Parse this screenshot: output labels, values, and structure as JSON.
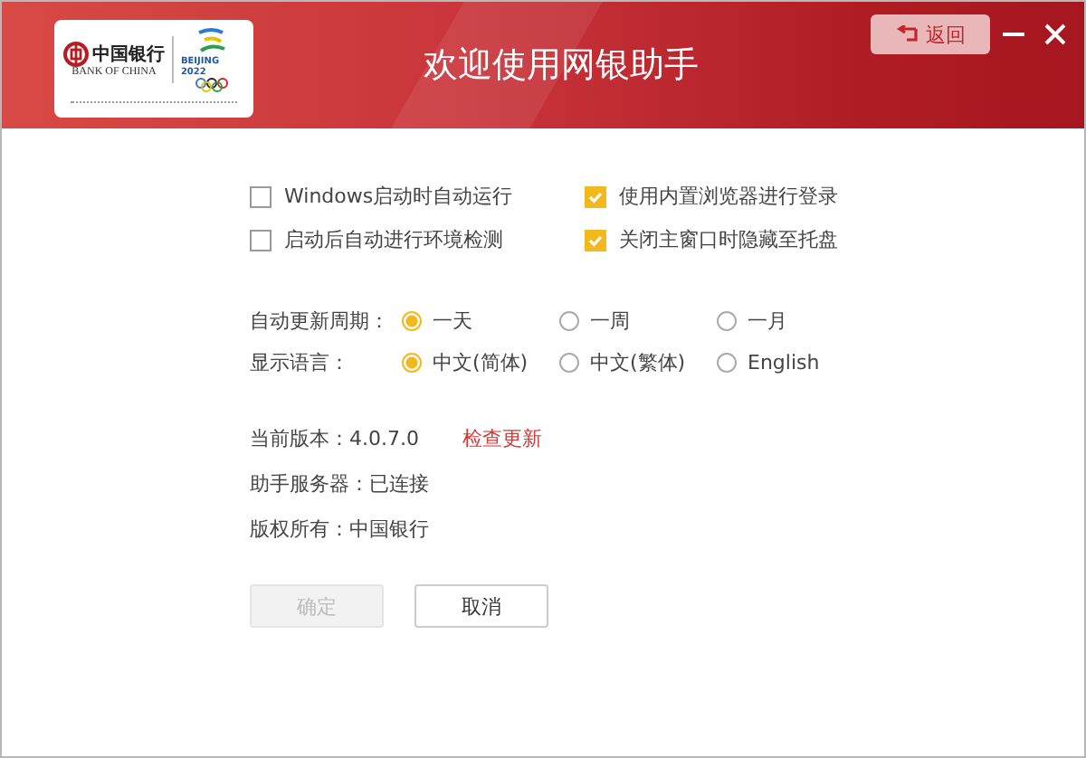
{
  "header": {
    "logo": {
      "bank_name": "中国银行",
      "bank_name_en": "BANK OF CHINA",
      "games": "BEIJING 2022"
    },
    "title": "欢迎使用网银助手",
    "back_button": "返回"
  },
  "options": [
    {
      "label": "Windows启动时自动运行",
      "checked": false
    },
    {
      "label": "使用内置浏览器进行登录",
      "checked": true
    },
    {
      "label": "启动后自动进行环境检测",
      "checked": false
    },
    {
      "label": "关闭主窗口时隐藏至托盘",
      "checked": true
    }
  ],
  "settings": [
    {
      "label": "自动更新周期：",
      "choices": [
        {
          "label": "一天",
          "selected": true
        },
        {
          "label": "一周",
          "selected": false
        },
        {
          "label": "一月",
          "selected": false
        }
      ]
    },
    {
      "label": "显示语言：",
      "choices": [
        {
          "label": "中文(简体)",
          "selected": true
        },
        {
          "label": "中文(繁体)",
          "selected": false
        },
        {
          "label": "English",
          "selected": false
        }
      ]
    }
  ],
  "info": [
    {
      "text": "当前版本：4.0.7.0",
      "link": "检查更新"
    },
    {
      "text": "助手服务器：已连接"
    },
    {
      "text": "版权所有：中国银行"
    }
  ],
  "buttons": [
    {
      "label": "确定",
      "disabled": true
    },
    {
      "label": "取消",
      "disabled": false
    }
  ]
}
